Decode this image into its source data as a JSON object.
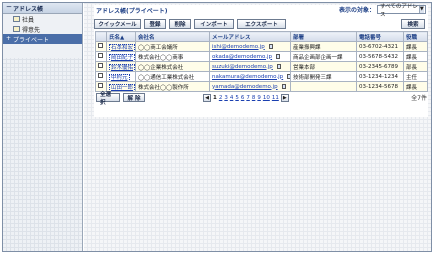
{
  "sidebar": {
    "title": "アドレス帳",
    "items": [
      {
        "label": "社員"
      },
      {
        "label": "得意先"
      },
      {
        "label": "プライベート"
      }
    ]
  },
  "main": {
    "title": "アドレス帳(プライベート)",
    "target_label": "表示の対象：",
    "target_value": "すべてのアドレス",
    "toolbar": {
      "quick_mail": "クイックメール",
      "register": "登録",
      "delete": "削除",
      "import": "インポート",
      "export": "エクスポート",
      "search": "検索"
    },
    "table": {
      "headers": [
        "",
        "氏名▲",
        "会社名",
        "メールアドレス",
        "部署",
        "電話番号",
        "役職"
      ],
      "rows": [
        {
          "name": "石本和宏",
          "company": "◯◯商工会議所",
          "email": "ishi@demodemo.jp",
          "dept": "産業振興課",
          "phone": "03-6702-4321",
          "title": "課長"
        },
        {
          "name": "岡田紀子",
          "company": "株式会社◯◯商事",
          "email": "okada@demodemo.jp",
          "dept": "商品企画部企画一課",
          "phone": "03-5678-5432",
          "title": "課長"
        },
        {
          "name": "鈴木優佑",
          "company": "◯◯企業株式会社",
          "email": "suzuki@demodemo.jp",
          "dept": "営業本部",
          "phone": "03-2345-6789",
          "title": "部長"
        },
        {
          "name": "中村元",
          "company": "◯◯通信工業株式会社",
          "email": "nakamura@demodemo.jp",
          "dept": "技術部開発三課",
          "phone": "03-1234-1234",
          "title": "主任"
        },
        {
          "name": "山田一郎",
          "company": "株式会社◯◯製作所",
          "email": "yamada@demodemo.jp",
          "dept": "",
          "phone": "03-1234-5678",
          "title": "課長"
        }
      ]
    },
    "footer": {
      "select_all": "全選択",
      "clear": "解 除",
      "prev": "◀",
      "next": "▶",
      "pages": [
        "1",
        "2",
        "3",
        "4",
        "5",
        "6",
        "7",
        "8",
        "9",
        "10",
        "11"
      ],
      "current_page": "1",
      "total": "全7件"
    }
  }
}
